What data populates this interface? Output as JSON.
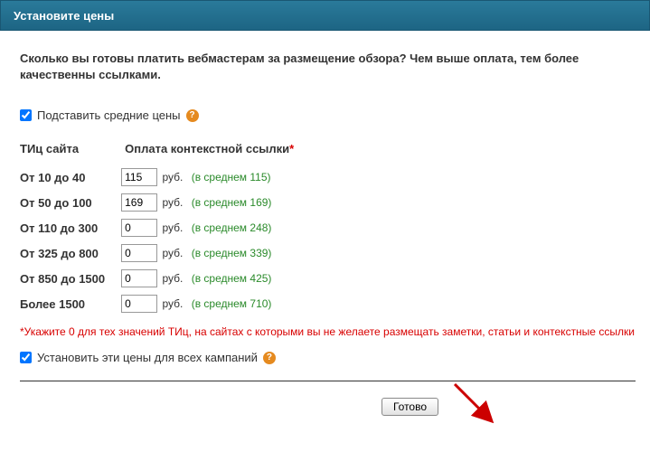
{
  "header": {
    "title": "Установите цены"
  },
  "intro": "Сколько вы готовы платить вебмастерам за размещение обзора? Чем выше оплата, тем более качественны ссылками.",
  "option_avg": {
    "checked": true,
    "label": "Подставить средние цены"
  },
  "columns": {
    "tic": "ТИц сайта",
    "pay": "Оплата контекстной ссылки",
    "asterisk": "*"
  },
  "currency": "руб.",
  "avg_prefix": "(в среднем ",
  "avg_suffix": ")",
  "rows": [
    {
      "range": "От 10 до 40",
      "value": "115",
      "avg": "115"
    },
    {
      "range": "От 50 до 100",
      "value": "169",
      "avg": "169"
    },
    {
      "range": "От 110 до 300",
      "value": "0",
      "avg": "248"
    },
    {
      "range": "От 325 до 800",
      "value": "0",
      "avg": "339"
    },
    {
      "range": "От 850 до 1500",
      "value": "0",
      "avg": "425"
    },
    {
      "range": "Более 1500",
      "value": "0",
      "avg": "710"
    }
  ],
  "note": "*Укажите 0 для тех значений ТИц, на сайтах с которыми вы не желаете размещать заметки, статьи и контекстные ссылки",
  "option_all": {
    "checked": true,
    "label": "Установить эти цены для всех кампаний"
  },
  "submit": "Готово"
}
